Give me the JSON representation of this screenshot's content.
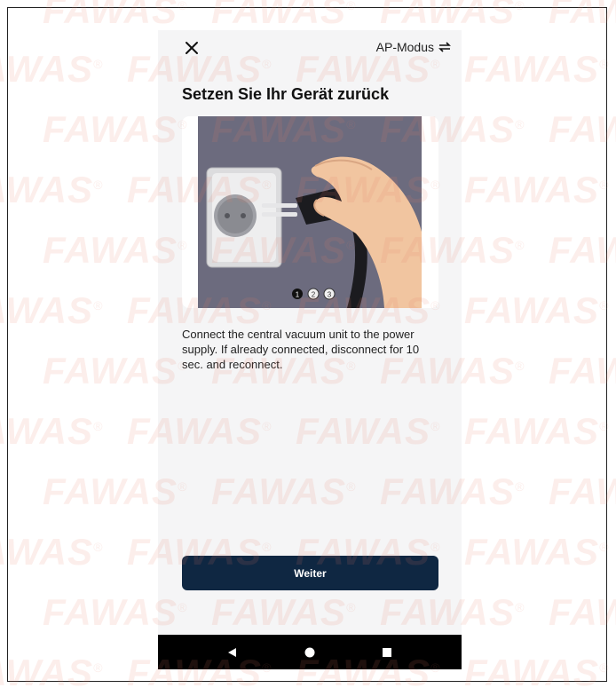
{
  "header": {
    "close_icon": "close-icon",
    "mode_label": "AP-Modus",
    "mode_icon": "swap-arrows-icon"
  },
  "main": {
    "title": "Setzen Sie Ihr Gerät zurück",
    "illustration": {
      "subject": "hand-plugging-into-wall-socket",
      "steps": [
        "1",
        "2",
        "3"
      ],
      "active_step": 1
    },
    "description": "Connect the central vacuum unit to the power supply. If already connected, disconnect for 10 sec. and reconnect.",
    "continue_label": "Weiter"
  },
  "navbar": {
    "back_icon": "back-triangle-icon",
    "home_icon": "home-circle-icon",
    "recents_icon": "recents-square-icon"
  },
  "watermark": {
    "text": "FAWAS",
    "mark": "®"
  },
  "colors": {
    "background": "#f5f5f6",
    "button": "#0f2742",
    "illustration_bg": "#6c6b7e",
    "navbar": "#000000"
  }
}
